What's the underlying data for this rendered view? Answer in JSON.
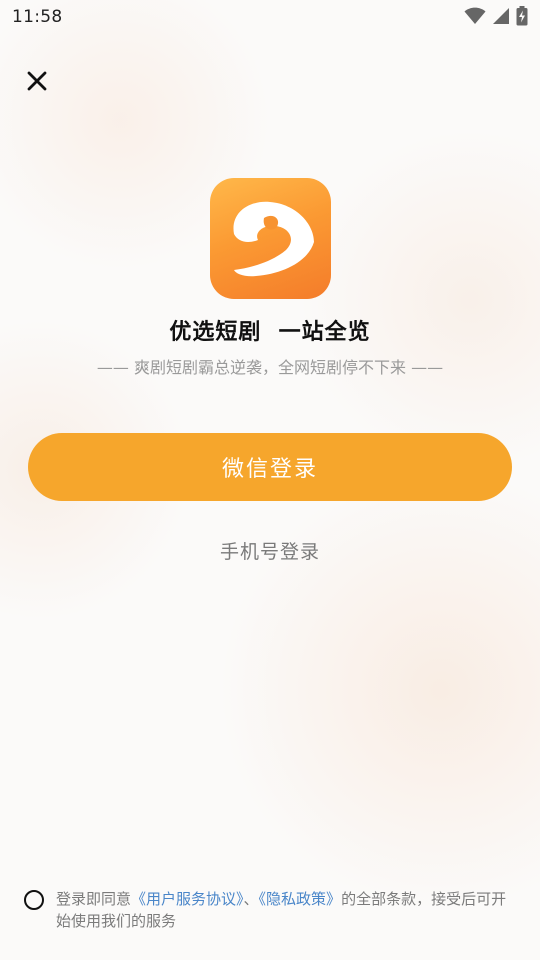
{
  "status_bar": {
    "time": "11:58",
    "icons": [
      "wifi-icon",
      "signal-icon",
      "battery-charging-icon"
    ]
  },
  "close": {
    "icon": "close-icon"
  },
  "app": {
    "logo_icon": "app-logo-icon",
    "title": "优选短剧  一站全览",
    "subtitle": "—— 爽剧短剧霸总逆袭，全网短剧停不下来 ——"
  },
  "login": {
    "wechat_label": "微信登录",
    "phone_label": "手机号登录"
  },
  "agreement": {
    "prefix": "登录即同意",
    "user_agreement": "《用户服务协议》",
    "separator": "、",
    "privacy_policy": "《隐私政策》",
    "suffix": "的全部条款，接受后可开始使用我们的服务",
    "checked": false
  },
  "colors": {
    "primary_button": "#f6a62c",
    "link": "#4a86c9",
    "logo_gradient_start": "#ffb84a",
    "logo_gradient_end": "#f47c2a"
  }
}
